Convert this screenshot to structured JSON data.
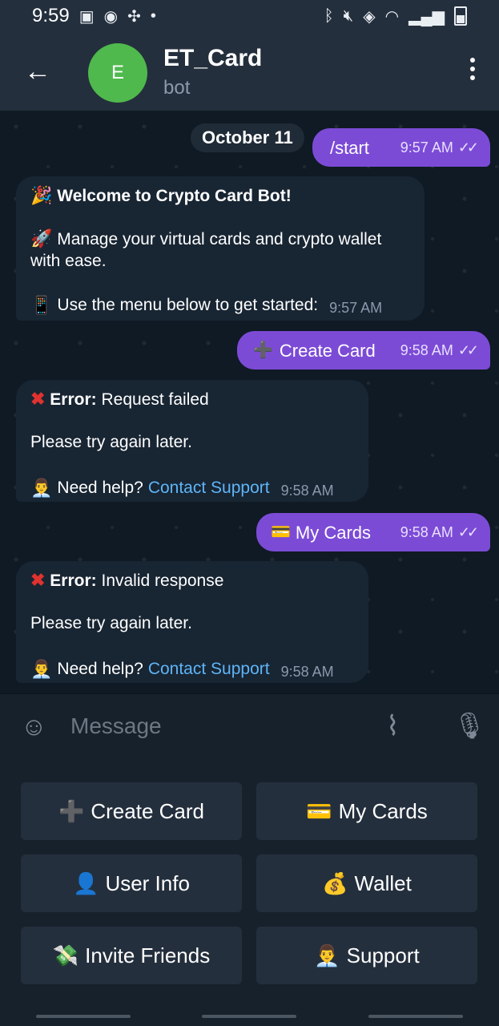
{
  "status_bar": {
    "time": "9:59",
    "icons_left": [
      "gallery-icon",
      "snapchat-icon",
      "pinwheel-icon",
      "dot-icon"
    ],
    "icons_right": [
      "bluetooth-icon",
      "mute-icon",
      "nfc-icon",
      "wifi-icon",
      "signal-icon",
      "battery-icon"
    ]
  },
  "header": {
    "back_icon": "back-arrow-icon",
    "avatar_letter": "E",
    "avatar_color": "#4fb94d",
    "title": "ET_Card",
    "subtitle": "bot",
    "menu_icon": "kebab-menu-icon"
  },
  "chat": {
    "date_label": "October 11",
    "messages": [
      {
        "dir": "out",
        "text": "/start",
        "time": "9:57 AM",
        "ticks": "✓✓"
      },
      {
        "dir": "in",
        "line1_emoji": "🎉",
        "line1_text": "Welcome to Crypto Card Bot!",
        "line2_emoji": "🚀",
        "line2_text": "Manage your virtual cards and crypto wallet with ease.",
        "line3_emoji": "📱",
        "line3_text": "Use the menu below to get started:",
        "time": "9:57 AM"
      },
      {
        "dir": "out",
        "emoji": "➕",
        "text": "Create Card",
        "time": "9:58 AM",
        "ticks": "✓✓"
      },
      {
        "dir": "in",
        "error_label": "Error:",
        "error_text": "Request failed",
        "retry_text": "Please try again later.",
        "help_emoji": "👨‍💼",
        "help_text": "Need help?",
        "link_text": "Contact Support",
        "time": "9:58 AM"
      },
      {
        "dir": "out",
        "emoji": "💳",
        "text": "My Cards",
        "time": "9:58 AM",
        "ticks": "✓✓"
      },
      {
        "dir": "in",
        "error_label": "Error:",
        "error_text": "Invalid response",
        "retry_text": "Please try again later.",
        "help_emoji": "👨‍💼",
        "help_text": "Need help?",
        "link_text": "Contact Support",
        "time": "9:58 AM"
      }
    ]
  },
  "composer": {
    "emoji_icon": "smiley-icon",
    "placeholder": "Message",
    "attach_icon": "paperclip-icon",
    "mic_icon": "microphone-icon"
  },
  "keyboard": {
    "buttons": [
      {
        "emoji": "➕",
        "label": "Create Card"
      },
      {
        "emoji": "💳",
        "label": "My Cards"
      },
      {
        "emoji": "👤",
        "label": "User Info"
      },
      {
        "emoji": "💰",
        "label": "Wallet"
      },
      {
        "emoji": "💸",
        "label": "Invite Friends"
      },
      {
        "emoji": "👨‍💼",
        "label": "Support"
      }
    ]
  },
  "colors": {
    "outgoing_bubble": "#7c4bd6",
    "incoming_bubble": "#182533",
    "link": "#5eb5f7",
    "error": "#e0322f",
    "header_bg": "#242f3d"
  }
}
